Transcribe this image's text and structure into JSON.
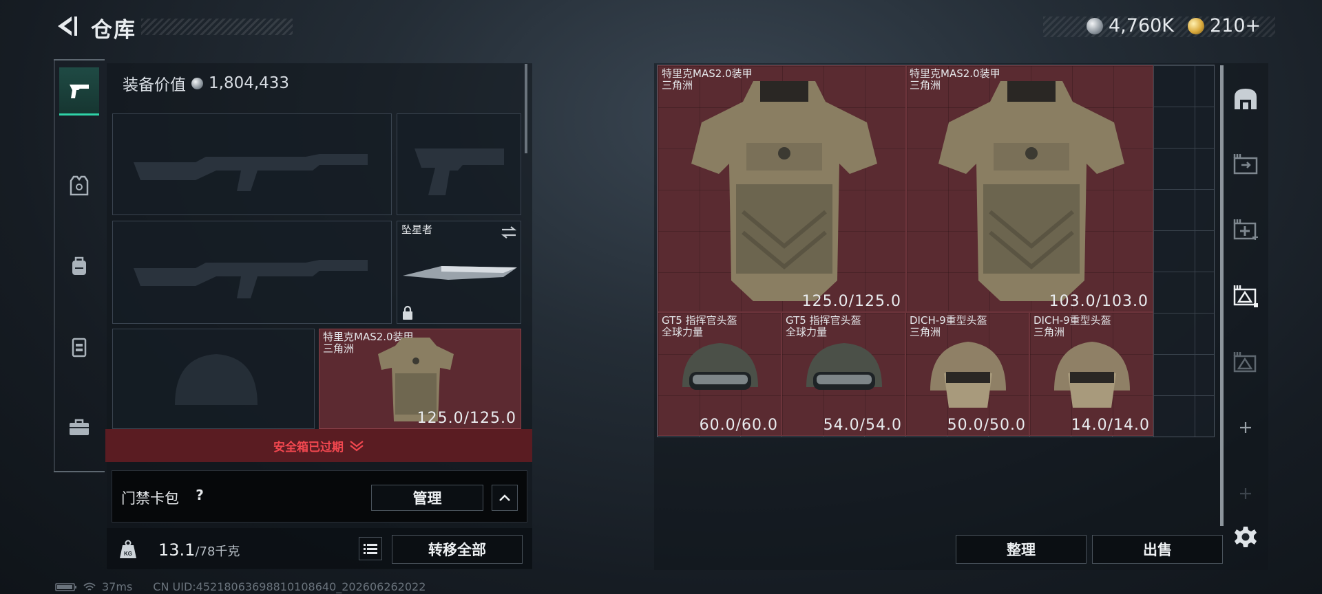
{
  "header": {
    "title": "仓库",
    "currencies": [
      {
        "icon": "silver-coin-icon",
        "value": "4,760K"
      },
      {
        "icon": "gold-coin-icon",
        "value": "210+"
      }
    ]
  },
  "left_rail": [
    {
      "name": "pistol-icon",
      "active": true
    },
    {
      "name": "armor-vest-icon"
    },
    {
      "name": "backpack-icon"
    },
    {
      "name": "chest-rig-icon"
    },
    {
      "name": "toolbox-icon"
    }
  ],
  "equipment": {
    "value_label": "装备价值",
    "value": "1,804,433",
    "melee": {
      "name": "坠星者"
    },
    "armor": {
      "name": "特里克MAS2.0装甲",
      "source": "三角洲",
      "durability": "125.0/125.0"
    },
    "safebox_status": "安全箱已过期",
    "keycard_label": "门禁卡包",
    "keycard_help": "?",
    "manage_label": "管理",
    "weight_value": "13.1",
    "weight_cap": "/78千克",
    "weight_icon_label": "KG",
    "transfer_all_label": "转移全部"
  },
  "stash": {
    "items": [
      {
        "name": "特里克MAS2.0装甲",
        "source": "三角洲",
        "durability": "125.0/125.0"
      },
      {
        "name": "特里克MAS2.0装甲",
        "source": "三角洲",
        "durability": "103.0/103.0"
      },
      {
        "name": "GT5 指挥官头盔",
        "source": "全球力量",
        "durability": "60.0/60.0"
      },
      {
        "name": "GT5 指挥官头盔",
        "source": "全球力量",
        "durability": "54.0/54.0"
      },
      {
        "name": "DICH-9重型头盔",
        "source": "三角洲",
        "durability": "50.0/50.0"
      },
      {
        "name": "DICH-9重型头盔",
        "source": "三角洲",
        "durability": "14.0/14.0"
      }
    ],
    "sort_label": "整理",
    "sell_label": "出售"
  },
  "right_rail": [
    "safehouse-icon",
    "stash-transfer-icon",
    "add-stash-icon",
    "stash-warning-icon",
    "stash-warning-dim-icon",
    "plus-icon",
    "plus-dim-icon",
    "gear-icon"
  ],
  "status": {
    "ping": "37ms",
    "uid": "CN UID:4521806369881010864​0_202606262022"
  },
  "colors": {
    "accent": "#2fd3a8",
    "item_red": "#5a2b31",
    "warning_red": "#f1474f"
  }
}
